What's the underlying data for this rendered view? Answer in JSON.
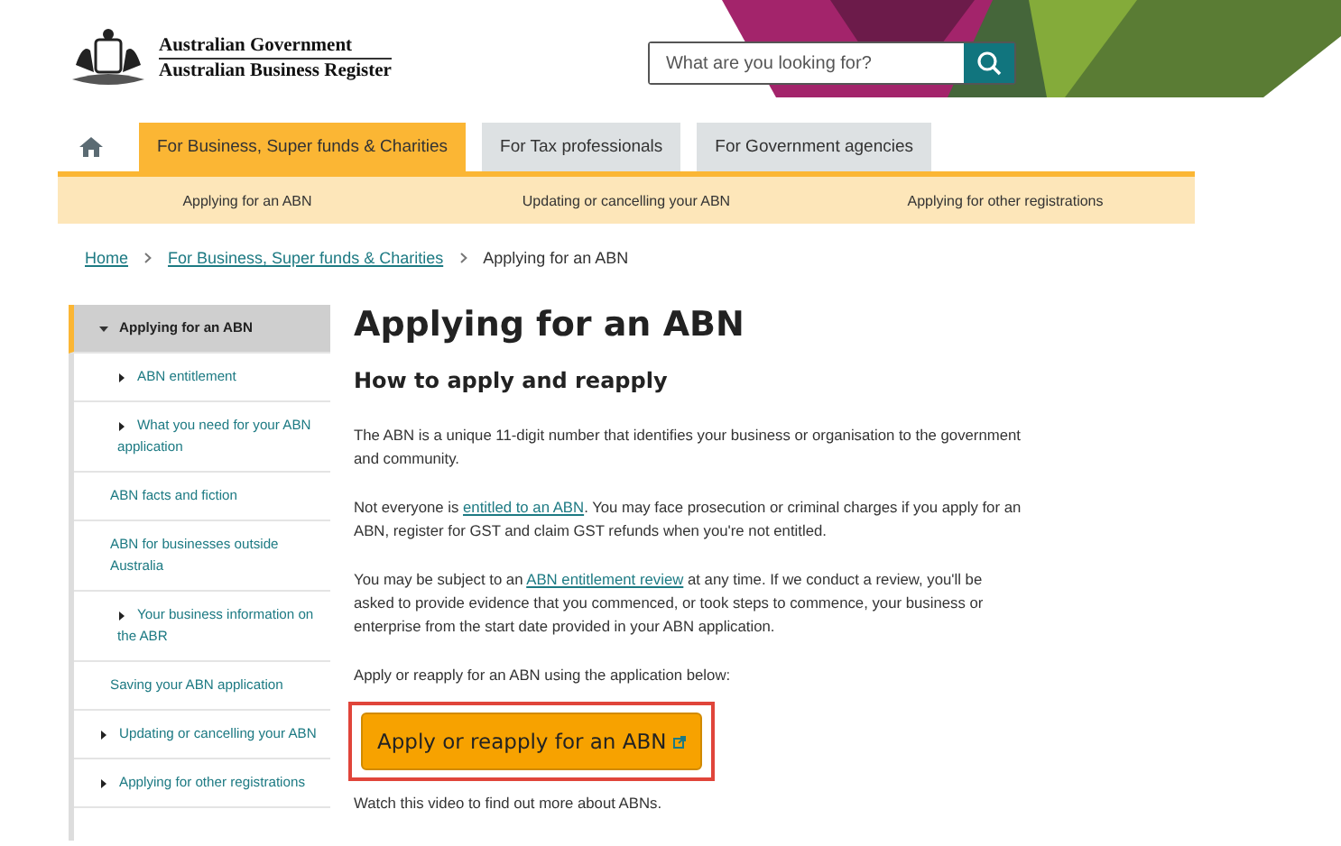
{
  "header": {
    "logo_lines": [
      "Australian Government",
      "Australian Business Register"
    ],
    "search": {
      "placeholder": "What are you looking for?"
    }
  },
  "nav": {
    "tabs": [
      {
        "label": "For Business, Super funds & Charities",
        "selected": true
      },
      {
        "label": "For Tax professionals",
        "selected": false
      },
      {
        "label": "For Government agencies",
        "selected": false
      }
    ],
    "subnav": [
      "Applying for an ABN",
      "Updating or cancelling your ABN",
      "Applying for other registrations"
    ]
  },
  "breadcrumb": {
    "links": [
      "Home",
      "For Business, Super funds & Charities"
    ],
    "current": "Applying for an ABN"
  },
  "sidebar": {
    "items": [
      {
        "label": "Applying for an ABN",
        "expanded": true,
        "selected": true,
        "children": [
          {
            "label": "ABN entitlement",
            "kind": "expandable"
          },
          {
            "label": "What you need for your ABN application",
            "kind": "expandable"
          },
          {
            "label": "ABN facts and fiction",
            "kind": "link"
          },
          {
            "label": "ABN for businesses outside Australia",
            "kind": "link"
          },
          {
            "label": "Your business information on the ABR",
            "kind": "expandable"
          },
          {
            "label": "Saving your ABN application",
            "kind": "link"
          }
        ]
      },
      {
        "label": "Updating or cancelling your ABN",
        "expanded": false,
        "selected": false
      },
      {
        "label": "Applying for other registrations",
        "expanded": false,
        "selected": false
      }
    ]
  },
  "main": {
    "title": "Applying for an ABN",
    "subtitle": "How to apply and reapply",
    "paragraphs": [
      [
        {
          "text": "The ABN is a unique 11-digit number that identifies your business or organisation to the government and community."
        }
      ],
      [
        {
          "text": "Not everyone is "
        },
        {
          "link": "entitled to an ABN"
        },
        {
          "text": ". You may face prosecution or criminal charges if you apply for an ABN, register for GST and claim GST refunds when you're not entitled."
        }
      ],
      [
        {
          "text": "You may be subject to an "
        },
        {
          "link": "ABN entitlement review"
        },
        {
          "text": " at any time. If we conduct a review, you'll be asked to provide evidence that you commenced, or took steps to commence, your business or enterprise from the start date provided in your ABN application."
        }
      ],
      [
        {
          "text": "Apply or reapply for an ABN using the application below:"
        }
      ]
    ],
    "button": {
      "label": "Apply or reapply for an ABN",
      "highlighted": true
    },
    "after": "Watch this video to find out more about ABNs."
  }
}
